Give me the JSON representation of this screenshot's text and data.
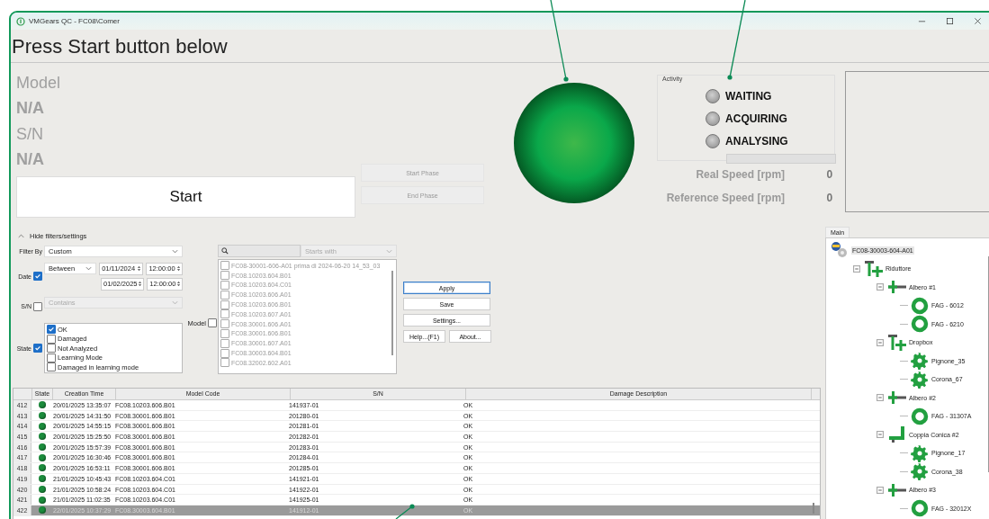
{
  "window": {
    "title": "VMGears QC - FC08\\Comer"
  },
  "header": "Press Start button below",
  "info": [
    {
      "label": "Model",
      "value": "N/A"
    },
    {
      "label": "S/N",
      "value": "N/A"
    }
  ],
  "start_button": "Start",
  "phase_buttons": [
    {
      "label": "Start Phase",
      "disabled": true
    },
    {
      "label": "End Phase",
      "disabled": true
    }
  ],
  "activity": {
    "title": "Activity",
    "indicators": [
      {
        "label": "WAITING",
        "on": false
      },
      {
        "label": "ACQUIRING",
        "on": false
      },
      {
        "label": "ANALYSING",
        "on": false
      }
    ]
  },
  "speeds": [
    {
      "label": "Real Speed [rpm]",
      "value": "0"
    },
    {
      "label": "Reference Speed [rpm]",
      "value": "0"
    }
  ],
  "filters": {
    "toggle": "Hide filters/settings",
    "filter_by": {
      "label": "Filter By",
      "value": "Custom"
    },
    "date": {
      "label": "Date",
      "checked": true,
      "mode": "Between",
      "from_date": "01/11/2024",
      "from_time": "12:00:00",
      "to_date": "01/02/2025",
      "to_time": "12:00:00"
    },
    "serial": {
      "label": "S/N",
      "checked": false,
      "mode": "Contains"
    },
    "state": {
      "label": "State",
      "checked": true,
      "options": [
        {
          "label": "OK",
          "checked": true
        },
        {
          "label": "Damaged",
          "checked": false
        },
        {
          "label": "Not Analyzed",
          "checked": false
        },
        {
          "label": "Learning Mode",
          "checked": false
        },
        {
          "label": "Damaged in learning mode",
          "checked": false
        }
      ]
    },
    "model": {
      "label": "Model",
      "checked": false,
      "match": "Starts with",
      "items": [
        {
          "label": "FC08-30001-606-A01 prima di 2024-06-20 14_53_03",
          "checked": false
        },
        {
          "label": "FC08.10203.604.B01",
          "checked": false
        },
        {
          "label": "FC08.10203.604.C01",
          "checked": false
        },
        {
          "label": "FC08.10203.606.A01",
          "checked": false
        },
        {
          "label": "FC08.10203.606.B01",
          "checked": false
        },
        {
          "label": "FC08.10203.607.A01",
          "checked": false
        },
        {
          "label": "FC08.30001.606.A01",
          "checked": false
        },
        {
          "label": "FC08.30001.606.B01",
          "checked": false
        },
        {
          "label": "FC08.30001.607.A01",
          "checked": false
        },
        {
          "label": "FC08.30003.604.B01",
          "checked": false
        },
        {
          "label": "FC08.32002.602.A01",
          "checked": false
        }
      ]
    }
  },
  "buttons": [
    {
      "label": "Apply",
      "focused": true
    },
    {
      "label": "Save",
      "focused": false
    },
    {
      "label": "Settings...",
      "focused": false
    },
    {
      "label": "Help...(F1)",
      "focused": false
    },
    {
      "label": "About...",
      "focused": false
    }
  ],
  "table": {
    "columns": [
      "State",
      "Creation Time",
      "Model Code",
      "S/N",
      "Damage Description"
    ],
    "rows": [
      {
        "index": "412",
        "color": "#1b8c3c",
        "time": "20/01/2025 13:35:07",
        "model": "FC08.10203.606.B01",
        "sn": "141937-01",
        "damage": "OK",
        "selected": false
      },
      {
        "index": "413",
        "color": "#1b8c3c",
        "time": "20/01/2025 14:31:50",
        "model": "FC08.30001.606.B01",
        "sn": "201280-01",
        "damage": "OK",
        "selected": false
      },
      {
        "index": "414",
        "color": "#1b8c3c",
        "time": "20/01/2025 14:55:15",
        "model": "FC08.30001.606.B01",
        "sn": "201281-01",
        "damage": "OK",
        "selected": false
      },
      {
        "index": "415",
        "color": "#1b8c3c",
        "time": "20/01/2025 15:25:50",
        "model": "FC08.30001.606.B01",
        "sn": "201282-01",
        "damage": "OK",
        "selected": false
      },
      {
        "index": "416",
        "color": "#1b8c3c",
        "time": "20/01/2025 15:57:39",
        "model": "FC08.30001.606.B01",
        "sn": "201283-01",
        "damage": "OK",
        "selected": false
      },
      {
        "index": "417",
        "color": "#1b8c3c",
        "time": "20/01/2025 16:30:46",
        "model": "FC08.30001.606.B01",
        "sn": "201284-01",
        "damage": "OK",
        "selected": false
      },
      {
        "index": "418",
        "color": "#1b8c3c",
        "time": "20/01/2025 16:53:11",
        "model": "FC08.30001.606.B01",
        "sn": "201285-01",
        "damage": "OK",
        "selected": false
      },
      {
        "index": "419",
        "color": "#1b8c3c",
        "time": "21/01/2025 10:45:43",
        "model": "FC08.10203.604.C01",
        "sn": "141921-01",
        "damage": "OK",
        "selected": false
      },
      {
        "index": "420",
        "color": "#1b8c3c",
        "time": "21/01/2025 10:58:24",
        "model": "FC08.10203.604.C01",
        "sn": "141922-01",
        "damage": "OK",
        "selected": false
      },
      {
        "index": "421",
        "color": "#1b8c3c",
        "time": "21/01/2025 11:02:35",
        "model": "FC08.10203.604.C01",
        "sn": "141925-01",
        "damage": "OK",
        "selected": false
      },
      {
        "index": "422",
        "color": "#1b8c3c",
        "time": "22/01/2025 10:37:29",
        "model": "FC08.30003.604.B01",
        "sn": "141912-01",
        "damage": "OK",
        "selected": true
      }
    ]
  },
  "tree": {
    "tab": "Main",
    "nodes": [
      {
        "kind": "root",
        "label": "FC08-30003-604-A01",
        "selected": true,
        "children": [
          {
            "kind": "assembly",
            "label": "Riduttore",
            "selected": false,
            "expanded": true,
            "children": [
              {
                "kind": "shaft",
                "label": "Albero #1",
                "selected": false,
                "expanded": true,
                "children": [
                  {
                    "kind": "bearing",
                    "label": "FAG - 6012",
                    "selected": false
                  },
                  {
                    "kind": "bearing",
                    "label": "FAG - 6210",
                    "selected": false
                  }
                ]
              },
              {
                "kind": "assembly",
                "label": "Dropbox",
                "selected": false,
                "expanded": true,
                "children": [
                  {
                    "kind": "gear",
                    "label": "Pignone_35",
                    "selected": false
                  },
                  {
                    "kind": "gear",
                    "label": "Corona_67",
                    "selected": false
                  }
                ]
              },
              {
                "kind": "shaft",
                "label": "Albero #2",
                "selected": false,
                "expanded": true,
                "children": [
                  {
                    "kind": "bearing",
                    "label": "FAG - 31307A",
                    "selected": false
                  }
                ]
              },
              {
                "kind": "bevel",
                "label": "Coppia Conica #2",
                "selected": false,
                "expanded": true,
                "children": [
                  {
                    "kind": "gear",
                    "label": "Pignone_17",
                    "selected": false
                  },
                  {
                    "kind": "gear",
                    "label": "Corona_38",
                    "selected": false
                  }
                ]
              },
              {
                "kind": "shaft",
                "label": "Albero #3",
                "selected": false,
                "expanded": true,
                "children": [
                  {
                    "kind": "bearing",
                    "label": "FAG - 32012X",
                    "selected": false
                  }
                ]
              }
            ]
          }
        ]
      }
    ]
  }
}
